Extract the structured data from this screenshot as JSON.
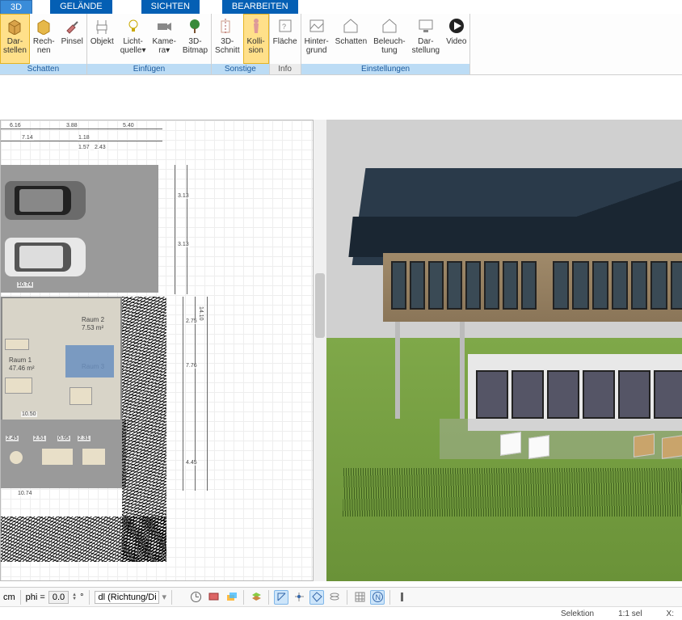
{
  "tabs": {
    "t3d": "3D",
    "gelaende": "GELÄNDE",
    "sichten": "SICHTEN",
    "bearbeiten": "BEARBEITEN"
  },
  "ribbon": {
    "schatten": {
      "label": "Schatten",
      "darstellen": "Dar-\nstellen",
      "rechnen": "Rech-\nnen",
      "pinsel": "Pinsel"
    },
    "einfuegen": {
      "label": "Einfügen",
      "objekt": "Objekt",
      "lichtquelle": "Licht-\nquelle▾",
      "kamera": "Kame-\nra▾",
      "bitmap": "3D-\nBitmap"
    },
    "sonstige": {
      "label": "Sonstige",
      "schnitt": "3D-\nSchnitt",
      "kollision": "Kolli-\nsion"
    },
    "info": {
      "label": "Info",
      "flaeche": "Fläche"
    },
    "einstellungen": {
      "label": "Einstellungen",
      "hintergrund": "Hinter-\ngrund",
      "schatten": "Schatten",
      "beleuchtung": "Beleuch-\ntung",
      "darstellung": "Dar-\nstellung",
      "video": "Video"
    }
  },
  "plan": {
    "raum1_name": "Raum 1",
    "raum1_area": "47.46 m²",
    "raum2_name": "Raum 2",
    "raum2_area": "7.53 m²",
    "raum3_name": "Raum 3",
    "dims": {
      "d1": "6.16",
      "d2": "3.88",
      "d3": "5.40",
      "d4": "7.14",
      "d5": "1.18",
      "d6": "1.57",
      "d7": "2.43",
      "d8": "10.74",
      "d9": "3.13",
      "d10": "14.10",
      "d11": "2.75",
      "d12": "7.76",
      "d13": "10.50",
      "d14": "10.74",
      "d15": "2.45",
      "d16": "2.51",
      "d17": "0.95",
      "d18": "2.31",
      "d19": "4.45"
    }
  },
  "bottom": {
    "cm": "cm",
    "phi_label": "phi =",
    "phi_value": "0.0",
    "deg": "°",
    "dl_select": "dl (Richtung/Di"
  },
  "status": {
    "selektion": "Selektion",
    "scale": "1:1 sel",
    "x": "X:"
  }
}
